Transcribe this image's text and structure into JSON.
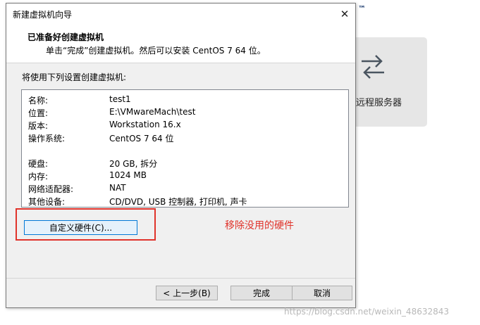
{
  "background": {
    "trademark": "™",
    "card_label": "远程服务器",
    "card_icon": "swap-arrows-icon"
  },
  "dialog": {
    "title": "新建虚拟机向导",
    "close_glyph": "✕",
    "header_title": "已准备好创建虚拟机",
    "header_subtitle": "单击“完成”创建虚拟机。然后可以安装 CentOS 7 64 位。",
    "intro": "将使用下列设置创建虚拟机:",
    "settings": [
      {
        "key": "名称:",
        "value": "test1"
      },
      {
        "key": "位置:",
        "value": "E:\\VMwareMach\\test"
      },
      {
        "key": "版本:",
        "value": "Workstation 16.x"
      },
      {
        "key": "操作系统:",
        "value": "CentOS 7 64 位"
      },
      {
        "key": "",
        "value": ""
      },
      {
        "key": "硬盘:",
        "value": "20 GB, 拆分"
      },
      {
        "key": "内存:",
        "value": "1024 MB"
      },
      {
        "key": "网络适配器:",
        "value": "NAT"
      },
      {
        "key": "其他设备:",
        "value": "CD/DVD, USB 控制器, 打印机, 声卡"
      }
    ],
    "customize_button": "自定义硬件(C)...",
    "back_button": "< 上一步(B)",
    "finish_button": "完成",
    "cancel_button": "取消"
  },
  "annotation": "移除没用的硬件",
  "watermark": "https://blog.csdn.net/weixin_48632843",
  "colors": {
    "annotation_red": "#e0332b",
    "focus_blue": "#0078d7"
  }
}
